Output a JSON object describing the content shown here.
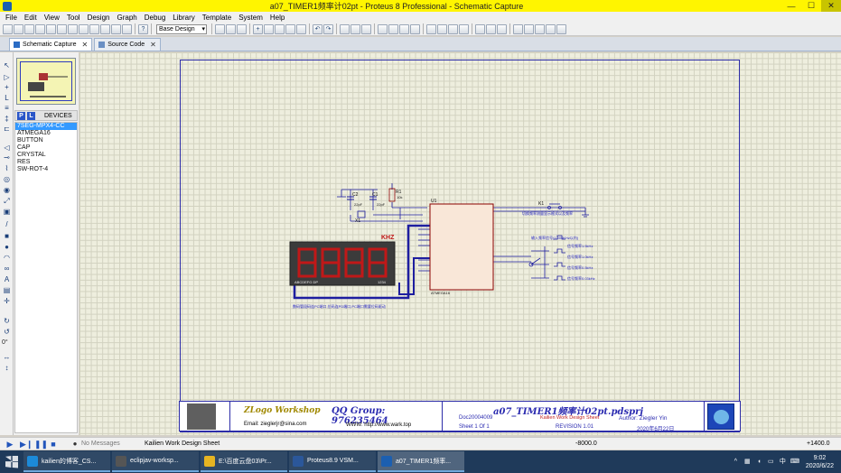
{
  "window": {
    "title": "a07_TIMER1频率计02pt - Proteus 8 Professional - Schematic Capture",
    "minimize": "—",
    "maximize": "☐",
    "close": "✕"
  },
  "menu": [
    "File",
    "Edit",
    "View",
    "Tool",
    "Design",
    "Graph",
    "Debug",
    "Library",
    "Template",
    "System",
    "Help"
  ],
  "toolbar": {
    "design_select": "Base Design"
  },
  "tabs": [
    {
      "label": "Schematic Capture",
      "close": "✕"
    },
    {
      "label": "Source Code",
      "close": "✕"
    }
  ],
  "left_tools": {
    "angle": "0°"
  },
  "sidebar": {
    "p_button": "P",
    "l_button": "L",
    "devices_label": "DEVICES",
    "devices": [
      "7SEG-MPX4-CC",
      "ATMEGA16",
      "BUTTON",
      "CAP",
      "CRYSTAL",
      "RES",
      "SW-ROT-4"
    ]
  },
  "schematic": {
    "c2": "C2",
    "c2_val": "22pF",
    "c1": "C1",
    "c1_val": "22pF",
    "x1": "X1",
    "r1": "R1",
    "r1_val": "10k",
    "u1": "U1",
    "u1_part": "ATMEGA16",
    "k1": "K1",
    "khz": "KHZ",
    "seg_pins_left": "ABCDEFG DP",
    "seg_pins_right": "1234",
    "note_k1": "切换频率测量显示格式以及频率",
    "note_rot": "输入频率信号(1.000KHz以内)",
    "sig1": "信号频率1.5kHz",
    "sig2": "信号频率1.0kHz",
    "sig3": "信号频率0.5kHz",
    "sig4": "信号频率0.03kHz",
    "note_bottom": "数码管段码连PC端口,位码连PD端口,PC端口需要位码驱动"
  },
  "titleblock": {
    "brand": "ZLogo Workshop",
    "qq": "QQ Group: 976235464",
    "email": "Email: zieglerjr@sina.com",
    "www": "WWW: http://www.wark.top",
    "filename": "a07_TIMER1频率计02pt.pdsprj",
    "doc": "Doc20004009",
    "desc": "Kailien Work Design Sheet",
    "author": "Author:  Ziegler Yin",
    "sheet": "Sheet  1    Of  1",
    "revision": "REVISION  1.01",
    "date": "2020年6月22日"
  },
  "status": {
    "messages": "No Messages",
    "sheet_name": "Kailien Work Design Sheet",
    "x": "-8000.0",
    "y": "+1400.0"
  },
  "taskbar": {
    "items": [
      {
        "label": "kailien的博客_CS...",
        "color": "#1c8ad8"
      },
      {
        "label": "eclipjav-worksp...",
        "color": "#444"
      },
      {
        "label": "E:\\百度云盘03\\Pr...",
        "color": "#e6b422"
      },
      {
        "label": "Proteus8.9 VSM...",
        "color": "#2b579a"
      },
      {
        "label": "a07_TIMER1频率...",
        "color": "#1c5fb0"
      }
    ],
    "ime": "中",
    "time": "9:02",
    "date": "2020/6/22"
  },
  "colors": {
    "titlebar": "#fff500",
    "wire": "#1e1ea0",
    "component": "#8b0000",
    "led_on": "#d82020"
  }
}
